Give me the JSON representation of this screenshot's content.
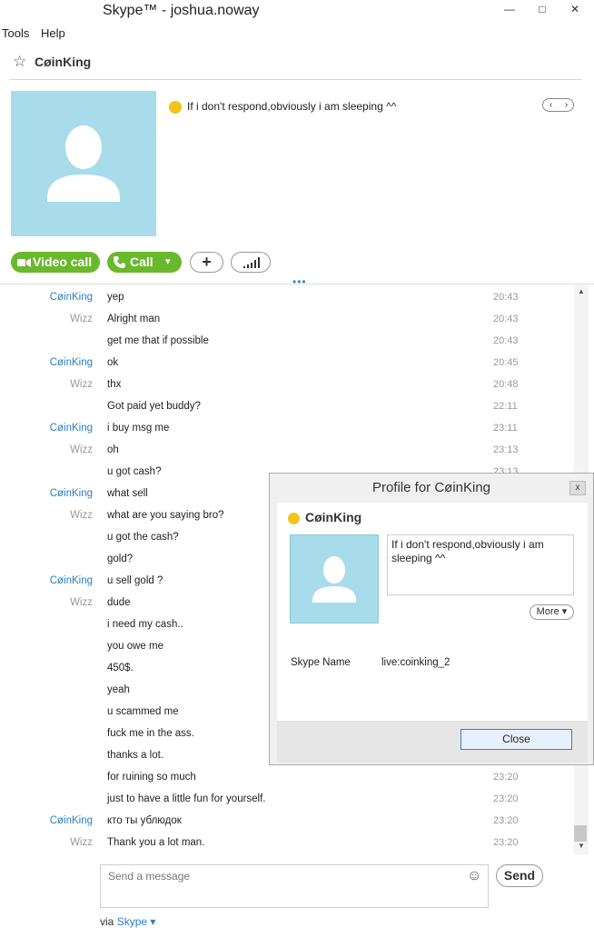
{
  "window": {
    "title": "Skype™ - joshua.noway",
    "minimize": "—",
    "maximize": "□",
    "close": "✕"
  },
  "menu": {
    "tools": "Tools",
    "help": "Help"
  },
  "contact": {
    "name": "CøinKing",
    "mood": "If i don't respond,obviously i am sleeping ^^",
    "pager_prev": "‹",
    "pager_next": "›"
  },
  "actions": {
    "video_call": "Video call",
    "call": "Call",
    "call_dropdown": "▾",
    "add": "+",
    "signal": "▂▃▅▇"
  },
  "grip": "•••",
  "messages": [
    {
      "sender": "CøinKing",
      "text": "yep",
      "time": "20:43"
    },
    {
      "sender": "Wizz",
      "text": "Alright man",
      "time": "20:43"
    },
    {
      "sender": "",
      "text": "get me that if possible",
      "time": "20:43"
    },
    {
      "sender": "CøinKing",
      "text": "ok",
      "time": "20:45"
    },
    {
      "sender": "Wizz",
      "text": "thx",
      "time": "20:48"
    },
    {
      "sender": "",
      "text": "Got paid yet buddy?",
      "time": "22:11"
    },
    {
      "sender": "CøinKing",
      "text": "i buy msg me",
      "time": "23:11"
    },
    {
      "sender": "Wizz",
      "text": "oh",
      "time": "23:13"
    },
    {
      "sender": "",
      "text": "u got cash?",
      "time": "23:13"
    },
    {
      "sender": "CøinKing",
      "text": "what sell",
      "time": ""
    },
    {
      "sender": "Wizz",
      "text": "what are you saying bro?",
      "time": ""
    },
    {
      "sender": "",
      "text": "u got the cash?",
      "time": ""
    },
    {
      "sender": "",
      "text": "gold?",
      "time": ""
    },
    {
      "sender": "CøinKing",
      "text": "u sell gold ?",
      "time": ""
    },
    {
      "sender": "Wizz",
      "text": "dude",
      "time": ""
    },
    {
      "sender": "",
      "text": "i need my cash..",
      "time": ""
    },
    {
      "sender": "",
      "text": "you owe me",
      "time": ""
    },
    {
      "sender": "",
      "text": "450$.",
      "time": ""
    },
    {
      "sender": "",
      "text": "yeah",
      "time": ""
    },
    {
      "sender": "",
      "text": "u scammed me",
      "time": ""
    },
    {
      "sender": "",
      "text": "fuck me in the ass.",
      "time": ""
    },
    {
      "sender": "",
      "text": "thanks a lot.",
      "time": ""
    },
    {
      "sender": "",
      "text": "for ruining so much",
      "time": "23:20"
    },
    {
      "sender": "",
      "text": "just to have a little fun for yourself.",
      "time": "23:20"
    },
    {
      "sender": "CøinKing",
      "text": "кто ты ублюдок",
      "time": "23:20"
    },
    {
      "sender": "Wizz",
      "text": "Thank you a lot man.",
      "time": "23:20"
    }
  ],
  "composer": {
    "placeholder": "Send a message",
    "send": "Send",
    "emoji": "☺",
    "via_prefix": "via",
    "via_link": "Skype ▾"
  },
  "profile": {
    "title": "Profile for CøinKing",
    "close_x": "x",
    "name": "CøinKing",
    "mood": "If i don't respond,obviously i am sleeping ^^",
    "more": "More ▾",
    "skype_name_label": "Skype Name",
    "skype_name_value": "live:coinking_2",
    "close": "Close"
  },
  "colors": {
    "accent_green": "#6ab82c",
    "link_blue": "#2a7dc6",
    "avatar_bg": "#a9dceb",
    "mood_yellow": "#f2c31c"
  }
}
